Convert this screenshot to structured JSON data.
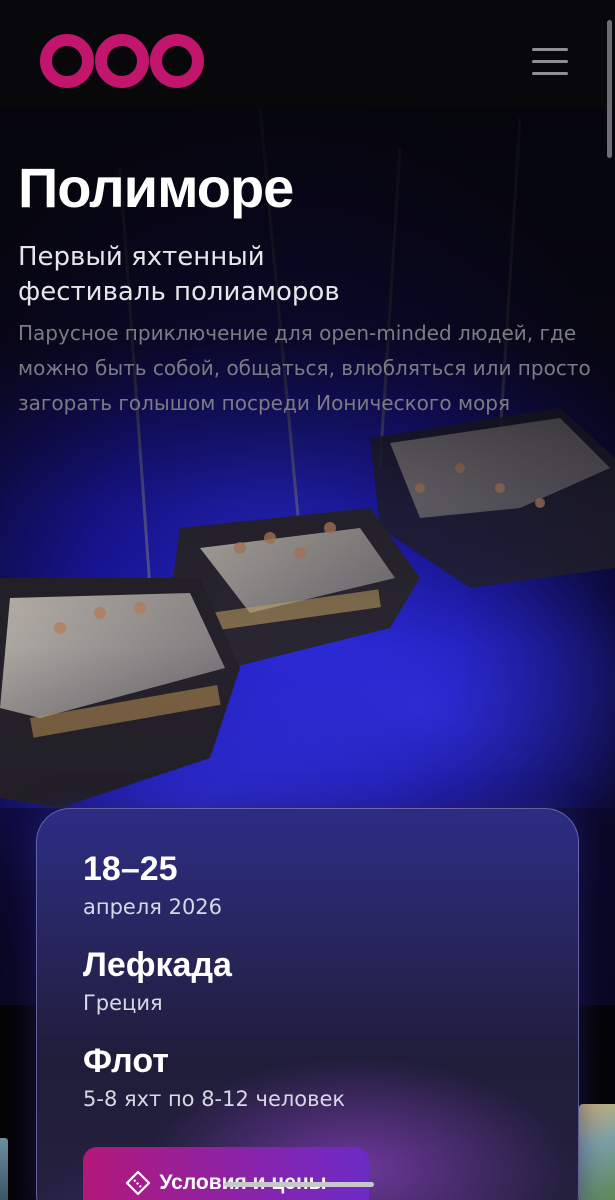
{
  "header": {
    "logo_icon": "triple-ring-logo-icon",
    "menu_icon": "hamburger-menu-icon",
    "brand_color": "#c2156e"
  },
  "hero": {
    "title": "Полиморе",
    "subtitle_line1": "Первый яхтенный",
    "subtitle_line2": "фестиваль полиаморов",
    "description": "Парусное приключение для open-minded людей, где можно быть собой, общаться, влюбляться или просто загорать голышом посреди Ионического моря"
  },
  "card": {
    "dates_value": "18–25",
    "dates_label": "апреля 2026",
    "place_value": "Лефкада",
    "place_label": "Греция",
    "fleet_value": "Флот",
    "fleet_label": "5-8 яхт по 8-12 человек",
    "cta_label": "Условия и цены",
    "cta_icon": "ticket-diamond-icon"
  },
  "colors": {
    "accent_pink": "#b3187a",
    "accent_purple": "#6c2bc6",
    "card_bg": "#2d2c84"
  }
}
